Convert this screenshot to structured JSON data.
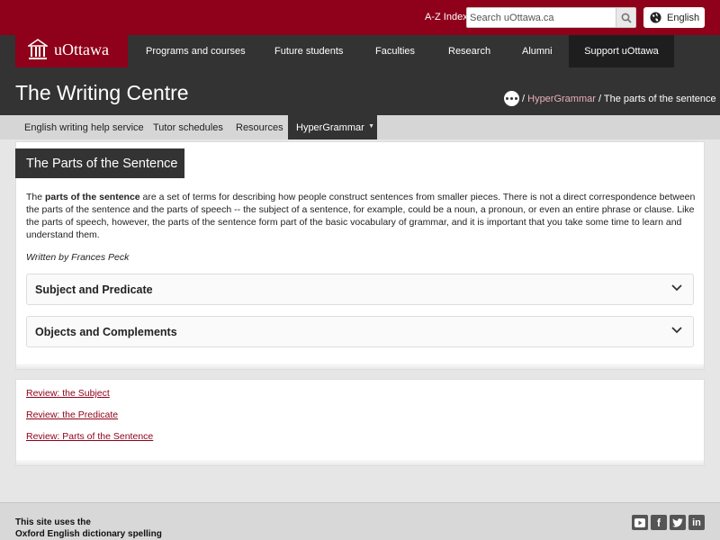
{
  "utility": {
    "az_index": "A-Z Index",
    "search_placeholder": "Search uOttawa.ca",
    "language": "English"
  },
  "logo": {
    "text": "uOttawa"
  },
  "main_nav": {
    "items": [
      {
        "label": "Programs and courses"
      },
      {
        "label": "Future students"
      },
      {
        "label": "Faculties"
      },
      {
        "label": "Research"
      },
      {
        "label": "Alumni"
      },
      {
        "label": "Support uOttawa"
      }
    ]
  },
  "site": {
    "title": "The Writing Centre"
  },
  "breadcrumb": {
    "sep1": "/",
    "link": "HyperGrammar",
    "sep2": "/",
    "current": "The parts of the sentence"
  },
  "sub_nav": {
    "items": [
      {
        "label": "English writing help service"
      },
      {
        "label": "Tutor schedules"
      },
      {
        "label": "Resources"
      },
      {
        "label": "HyperGrammar"
      }
    ]
  },
  "page": {
    "heading": "The Parts of the Sentence",
    "intro_bold": "parts of the sentence",
    "intro_the": "The",
    "intro_rest": " are a set of terms for describing how people construct sentences from smaller pieces. There is not a direct correspondence between the parts of the sentence and the parts of speech -- the subject of a sentence, for example, could be a noun, a pronoun, or even an entire phrase or clause. Like the parts of speech, however, the parts of the sentence form part of the basic vocabulary of grammar, and it is important that you take some time to learn and understand them.",
    "author": "Written by Frances Peck",
    "accordions": [
      {
        "title": "Subject and Predicate"
      },
      {
        "title": "Objects and Complements"
      }
    ]
  },
  "review_links": [
    {
      "label": "Review: the Subject"
    },
    {
      "label": "Review: the Predicate"
    },
    {
      "label": "Review: Parts of the Sentence"
    }
  ],
  "footer": {
    "line1": "This site uses the",
    "line2": "Oxford English dictionary spelling",
    "social": [
      {
        "icon": "youtube-icon"
      },
      {
        "icon": "facebook-icon"
      },
      {
        "icon": "twitter-icon"
      },
      {
        "icon": "linkedin-icon"
      }
    ]
  }
}
